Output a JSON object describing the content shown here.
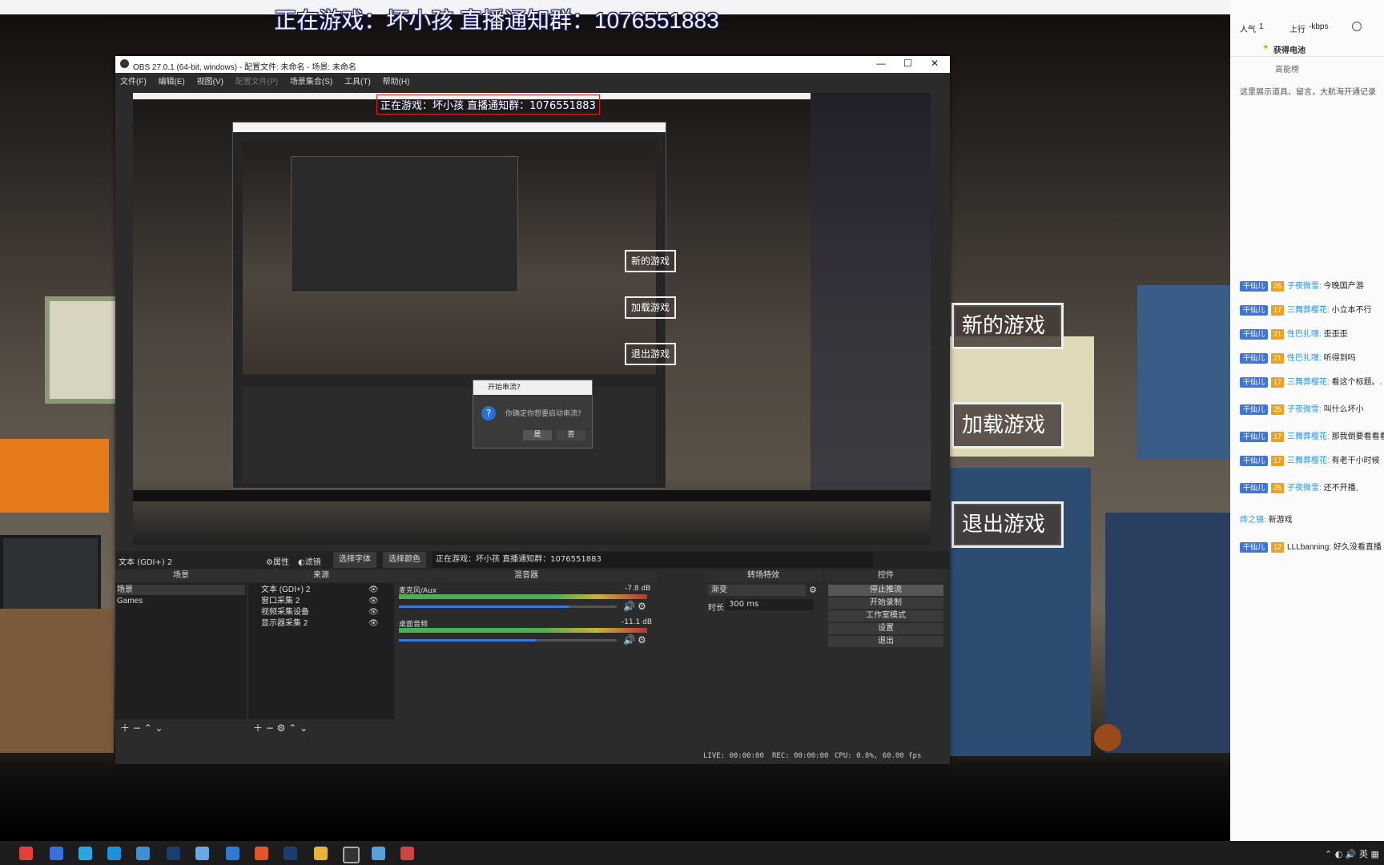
{
  "stream_title": "正在游戏：坏小孩 直播通知群：1076551883",
  "game_menu": {
    "new_game": "新的游戏",
    "load_game": "加载游戏",
    "quit_game": "退出游戏"
  },
  "chat": {
    "popularity_label": "人气",
    "popularity_value": "1",
    "upload_label": "上行",
    "upload_value": "-kbps",
    "battery_label": "获得电池",
    "rank_label": "高能榜",
    "notice": "这里展示道具、留言，大航海开通记录",
    "messages": [
      {
        "badge": "干仙儿",
        "level": "25",
        "user": "子夜微雪:",
        "text": "今晚国产游"
      },
      {
        "badge": "干仙儿",
        "level": "17",
        "user": "三舞葬樱花:",
        "text": "小立本不行"
      },
      {
        "badge": "干仙儿",
        "level": "21",
        "user": "性巴扎嘿:",
        "text": "歪歪歪"
      },
      {
        "badge": "干仙儿",
        "level": "21",
        "user": "性巴扎嘿:",
        "text": "听得到吗"
      },
      {
        "badge": "干仙儿",
        "level": "17",
        "user": "三舞葬樱花:",
        "text": "看这个标题。."
      },
      {
        "badge": "干仙儿",
        "level": "25",
        "user": "子夜微雪:",
        "text": "叫什么坏小"
      },
      {
        "badge": "干仙儿",
        "level": "17",
        "user": "三舞葬樱花:",
        "text": "那我倒要看看看"
      },
      {
        "badge": "干仙儿",
        "level": "17",
        "user": "三舞葬樱花:",
        "text": "有老干小时候"
      },
      {
        "badge": "干仙儿",
        "level": "25",
        "user": "子夜微雪:",
        "text": "还不开播,"
      },
      {
        "badge": "",
        "level": "",
        "user": "烨之镜:",
        "text": "新游戏"
      },
      {
        "badge": "干仙儿",
        "level": "12",
        "user": "",
        "text": "LLLbanning: 好久没看直播"
      }
    ]
  },
  "obs": {
    "window_title": "OBS 27.0.1 (64-bit, windows) - 配置文件: 未命名 - 场景: 未命名",
    "menu": [
      "文件(F)",
      "编辑(E)",
      "视图(V)",
      "配置文件(P)",
      "场景集合(S)",
      "工具(T)",
      "帮助(H)"
    ],
    "selected_source_label": "文本 (GDI+) 2",
    "properties_btn": "属性",
    "filters_btn": "滤镜",
    "select_font_btn": "选择字体",
    "select_color_btn": "选择颜色",
    "text_value": "正在游戏：坏小孩 直播通知群：1076551883",
    "docks": {
      "scenes": {
        "title": "场景",
        "items": [
          "场景",
          "Games"
        ]
      },
      "sources": {
        "title": "来源",
        "items": [
          "文本 (GDI+) 2",
          "窗口采集 2",
          "视频采集设备",
          "显示器采集 2"
        ]
      },
      "mixer": {
        "title": "混音器",
        "tracks": [
          {
            "name": "麦克风/Aux",
            "db": "-7.8 dB",
            "volume": 0.78
          },
          {
            "name": "桌面音频",
            "db": "-11.1 dB",
            "volume": 0.63
          }
        ],
        "scale": [
          "-60",
          "-55",
          "-50",
          "-45",
          "-40",
          "-35",
          "-30",
          "-25",
          "-20",
          "-15",
          "-10",
          "-5",
          "0"
        ]
      },
      "transitions": {
        "title": "转场特效",
        "type": "渐变",
        "duration_label": "时长",
        "duration_value": "300 ms"
      },
      "controls": {
        "title": "控件",
        "buttons": [
          "停止推流",
          "开始录制",
          "工作室模式",
          "设置",
          "退出"
        ]
      }
    },
    "status": {
      "live": "LIVE: 00:00:00",
      "rec": "REC: 00:00:00",
      "cpu": "CPU: 0.8%, 60.00 fps"
    }
  },
  "dialog": {
    "title": "开始串流?",
    "message": "你确定你想要启动串流?",
    "yes": "是",
    "no": "否"
  },
  "colors": {
    "badge_blue": "#3d77d9",
    "badge_level_orange": "#f0a020",
    "chat_user": "#2196f3",
    "obs_bg": "#2b2b2b",
    "meter_green": "#4caf50"
  }
}
